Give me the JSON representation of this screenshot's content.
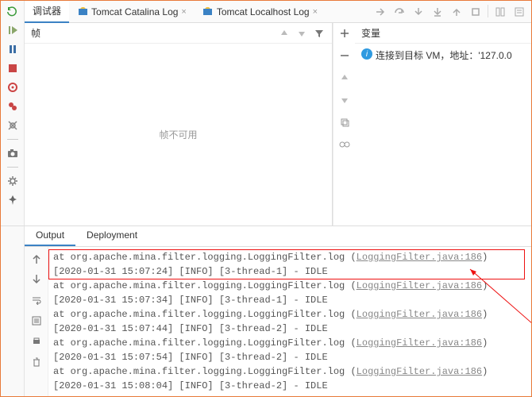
{
  "tabs": {
    "debugger": "调试器",
    "catalina": "Tomcat Catalina Log",
    "localhost": "Tomcat Localhost Log"
  },
  "frames": {
    "title": "帧",
    "empty": "帧不可用"
  },
  "vars": {
    "title": "变量",
    "msg": "连接到目标 VM，地址：'127.0.0"
  },
  "output": {
    "tabs": {
      "output": "Output",
      "deployment": "Deployment"
    },
    "filterLink": "LoggingFilter.java:186",
    "lines": [
      {
        "text": "at org.apache.mina.filter.logging.LoggingFilter.log (",
        "hasLink": true
      },
      {
        "text": "[2020-01-31 15:07:24] [INFO] [3-thread-1] - IDLE",
        "hasLink": false
      },
      {
        "text": "at org.apache.mina.filter.logging.LoggingFilter.log (",
        "hasLink": true
      },
      {
        "text": "[2020-01-31 15:07:34] [INFO] [3-thread-1] - IDLE",
        "hasLink": false
      },
      {
        "text": "at org.apache.mina.filter.logging.LoggingFilter.log (",
        "hasLink": true
      },
      {
        "text": "[2020-01-31 15:07:44] [INFO] [3-thread-2] - IDLE",
        "hasLink": false
      },
      {
        "text": "at org.apache.mina.filter.logging.LoggingFilter.log (",
        "hasLink": true
      },
      {
        "text": "[2020-01-31 15:07:54] [INFO] [3-thread-2] - IDLE",
        "hasLink": false
      },
      {
        "text": "at org.apache.mina.filter.logging.LoggingFilter.log (",
        "hasLink": true
      },
      {
        "text": "[2020-01-31 15:08:04] [INFO] [3-thread-2] - IDLE",
        "hasLink": false
      }
    ]
  }
}
